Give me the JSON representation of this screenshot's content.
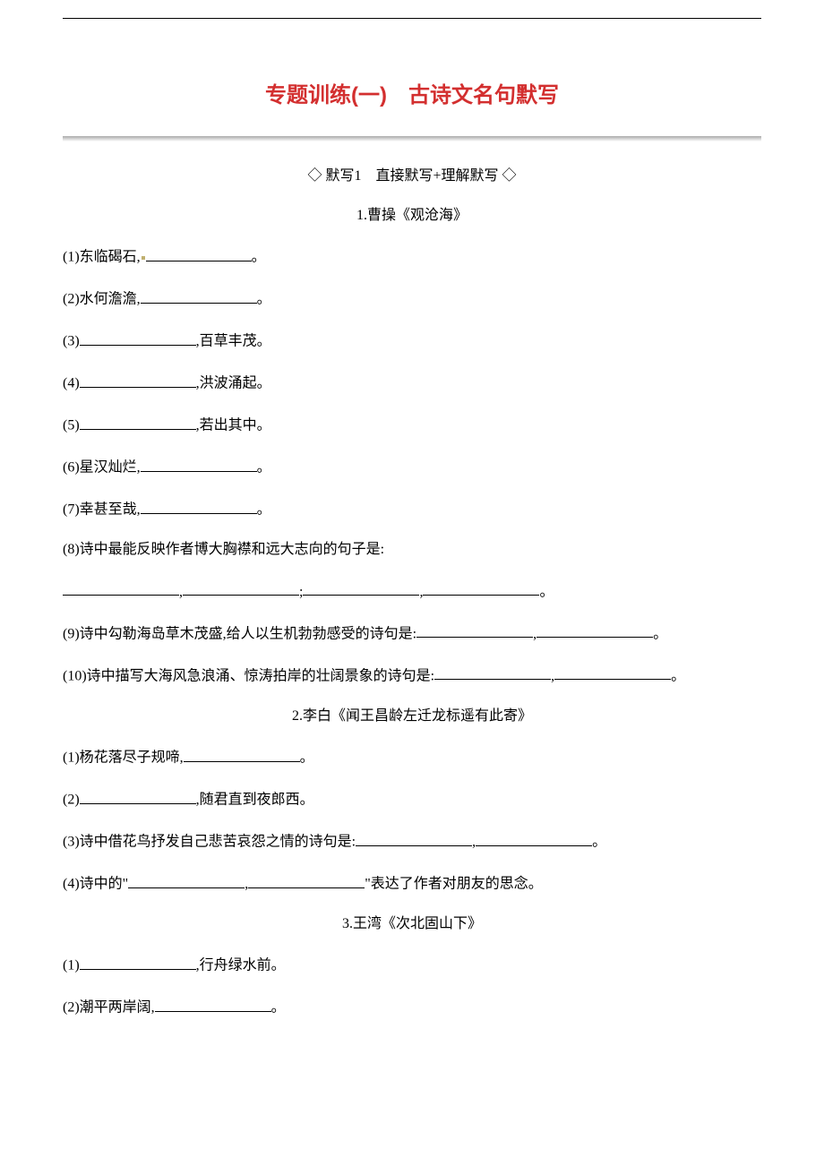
{
  "title": "专题训练(一)　古诗文名句默写",
  "section_header": "◇ 默写1　直接默写+理解默写 ◇",
  "poem1": {
    "title": "1.曹操《观沧海》",
    "q1": "(1)东临碣石,",
    "q2": "(2)水何澹澹,",
    "q3a": "(3)",
    "q3b": ",百草丰茂。",
    "q4a": "(4)",
    "q4b": ",洪波涌起。",
    "q5a": "(5)",
    "q5b": ",若出其中。",
    "q6": "(6)星汉灿烂,",
    "q7": "(7)幸甚至哉,",
    "q8": "(8)诗中最能反映作者博大胸襟和远大志向的句子是:",
    "q9": "(9)诗中勾勒海岛草木茂盛,给人以生机勃勃感受的诗句是:",
    "q10": "(10)诗中描写大海风急浪涌、惊涛拍岸的壮阔景象的诗句是:"
  },
  "poem2": {
    "title": "2.李白《闻王昌龄左迁龙标遥有此寄》",
    "q1": "(1)杨花落尽子规啼,",
    "q2a": "(2)",
    "q2b": ",随君直到夜郎西。",
    "q3": "(3)诗中借花鸟抒发自己悲苦哀怨之情的诗句是:",
    "q4a": "(4)诗中的\"",
    "q4b": "\"表达了作者对朋友的思念。"
  },
  "poem3": {
    "title": "3.王湾《次北固山下》",
    "q1a": "(1)",
    "q1b": ",行舟绿水前。",
    "q2": "(2)潮平两岸阔,"
  },
  "p": "。",
  "c": ",",
  "s": ";"
}
